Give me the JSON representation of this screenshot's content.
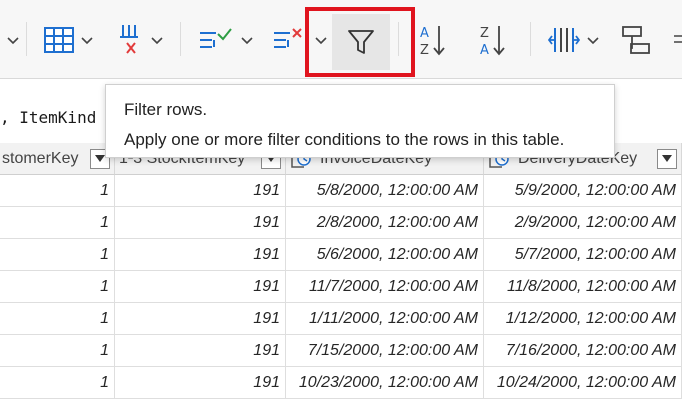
{
  "tooltip": {
    "title": "Filter rows.",
    "description": "Apply one or more filter conditions to the rows in this table."
  },
  "formula_bar": {
    "text": ", ItemKind"
  },
  "icons": {
    "table": "table-icon",
    "split_column": "split-column-icon",
    "keep_rows": "keep-rows-icon",
    "remove_rows": "remove-rows-icon",
    "filter": "filter-icon",
    "sort_ascending": "sort-ascending-icon",
    "sort_descending": "sort-descending-icon",
    "split": "split-icon",
    "group_by": "group-by-icon"
  },
  "colors": {
    "accent": "#1e6fd0",
    "highlight_border": "#e0141e",
    "remove_x": "#e23b3b",
    "keep_check": "#2e9e44"
  },
  "table": {
    "columns": [
      {
        "label": "stomerKey"
      },
      {
        "label": "1²3 StockItemKey"
      },
      {
        "label": "InvoiceDateKey"
      },
      {
        "label": "DeliveryDateKey"
      }
    ],
    "rows": [
      [
        "1",
        "191",
        "5/8/2000, 12:00:00 AM",
        "5/9/2000, 12:00:00 AM"
      ],
      [
        "1",
        "191",
        "2/8/2000, 12:00:00 AM",
        "2/9/2000, 12:00:00 AM"
      ],
      [
        "1",
        "191",
        "5/6/2000, 12:00:00 AM",
        "5/7/2000, 12:00:00 AM"
      ],
      [
        "1",
        "191",
        "11/7/2000, 12:00:00 AM",
        "11/8/2000, 12:00:00 AM"
      ],
      [
        "1",
        "191",
        "1/11/2000, 12:00:00 AM",
        "1/12/2000, 12:00:00 AM"
      ],
      [
        "1",
        "191",
        "7/15/2000, 12:00:00 AM",
        "7/16/2000, 12:00:00 AM"
      ],
      [
        "1",
        "191",
        "10/23/2000, 12:00:00 AM",
        "10/24/2000, 12:00:00 AM"
      ]
    ]
  }
}
